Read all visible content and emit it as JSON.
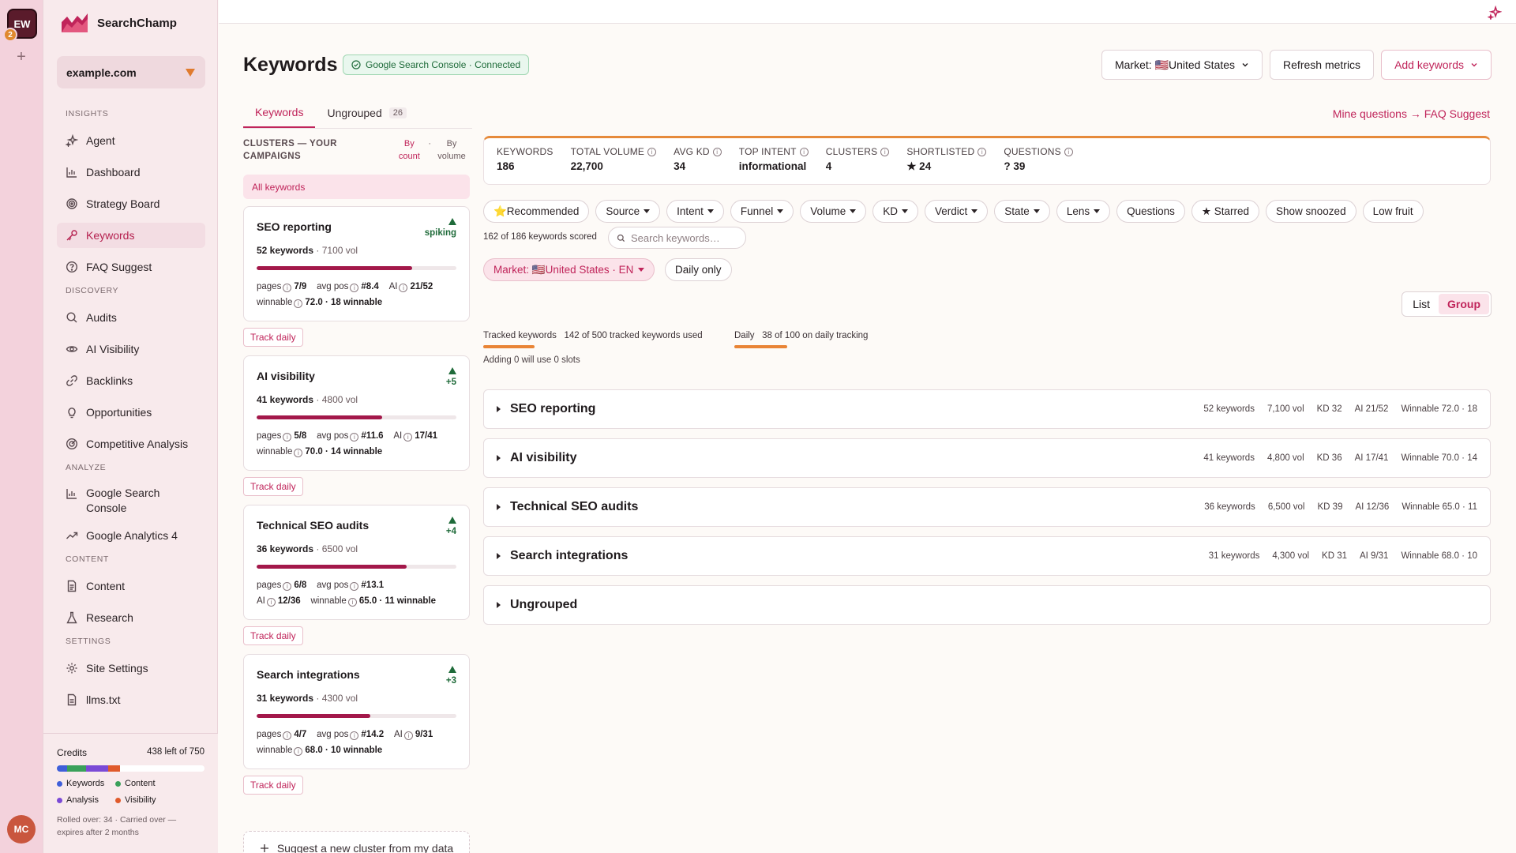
{
  "rail": {
    "workspace_initials": "EW",
    "workspace_badge": "2",
    "user_initials": "MC"
  },
  "sidebar": {
    "brand": "SearchChamp",
    "site": "example.com",
    "sections": {
      "insights": "INSIGHTS",
      "discovery": "DISCOVERY",
      "analyze": "ANALYZE",
      "content": "CONTENT",
      "settings": "SETTINGS"
    },
    "items": {
      "agent": "Agent",
      "dashboard": "Dashboard",
      "strategy_board": "Strategy Board",
      "keywords": "Keywords",
      "faq_suggest": "FAQ Suggest",
      "audits": "Audits",
      "ai_visibility": "AI Visibility",
      "backlinks": "Backlinks",
      "opportunities": "Opportunities",
      "competitive_analysis": "Competitive Analysis",
      "gsc": "Google Search Console",
      "ga4": "Google Analytics 4",
      "content": "Content",
      "research": "Research",
      "site_settings": "Site Settings",
      "llms": "llms.txt"
    },
    "credits": {
      "label": "Credits",
      "remaining": "438 left of 750",
      "segments": [
        {
          "name": "Keywords",
          "color": "#3f5fd9",
          "fraction": 0.07
        },
        {
          "name": "Content",
          "color": "#3aa05a",
          "fraction": 0.13
        },
        {
          "name": "Analysis",
          "color": "#7b4ad6",
          "fraction": 0.15
        },
        {
          "name": "Visibility",
          "color": "#e05a2b",
          "fraction": 0.08
        }
      ],
      "legend": {
        "keywords": "Keywords",
        "content": "Content",
        "analysis": "Analysis",
        "visibility": "Visibility"
      },
      "note": "Rolled over: 34 · Carried over — expires after 2 months"
    }
  },
  "header": {
    "title": "Keywords",
    "gsc_badge": "Google Search Console · Connected",
    "market_btn": "Market: 🇺🇸United States",
    "refresh_btn": "Refresh metrics",
    "add_btn": "Add keywords",
    "faq_link": "Mine questions → FAQ Suggest"
  },
  "tabs": [
    {
      "label": "Keywords"
    },
    {
      "label": "Ungrouped",
      "count": "26"
    }
  ],
  "clusters": {
    "heading": "CLUSTERS — YOUR CAMPAIGNS",
    "sort_by_count": "By count",
    "sort_by_volume": "By volume",
    "all_keywords": "All keywords",
    "track_label": "Track daily",
    "suggest_label": "Suggest a new cluster from my data",
    "labels": {
      "pages": "pages",
      "avg_pos": "avg pos",
      "ai": "AI",
      "winnable": "winnable"
    },
    "items": [
      {
        "name": "SEO reporting",
        "keywords": "52 keywords",
        "vol": "7100 vol",
        "trend": "spiking",
        "progress": 0.78,
        "pages": "7/9",
        "avg_pos": "#8.4",
        "ai": "21/52",
        "winnable": "72.0 · 18 winnable"
      },
      {
        "name": "AI visibility",
        "keywords": "41 keywords",
        "vol": "4800 vol",
        "trend": "+5",
        "progress": 0.63,
        "pages": "5/8",
        "avg_pos": "#11.6",
        "ai": "17/41",
        "winnable": "70.0 · 14 winnable"
      },
      {
        "name": "Technical SEO audits",
        "keywords": "36 keywords",
        "vol": "6500 vol",
        "trend": "+4",
        "progress": 0.75,
        "pages": "6/8",
        "avg_pos": "#13.1",
        "ai": "12/36",
        "winnable": "65.0 · 11 winnable"
      },
      {
        "name": "Search integrations",
        "keywords": "31 keywords",
        "vol": "4300 vol",
        "trend": "+3",
        "progress": 0.57,
        "pages": "4/7",
        "avg_pos": "#14.2",
        "ai": "9/31",
        "winnable": "68.0 · 10 winnable"
      }
    ]
  },
  "stats": [
    {
      "label": "KEYWORDS",
      "value": "186",
      "info": false
    },
    {
      "label": "TOTAL VOLUME",
      "value": "22,700",
      "info": true
    },
    {
      "label": "AVG KD",
      "value": "34",
      "info": true
    },
    {
      "label": "TOP INTENT",
      "value": "informational",
      "info": true
    },
    {
      "label": "CLUSTERS",
      "value": "4",
      "info": true
    },
    {
      "label": "SHORTLISTED",
      "value": "★ 24",
      "info": true
    },
    {
      "label": "QUESTIONS",
      "value": "? 39",
      "info": true
    }
  ],
  "filters": {
    "chips": [
      {
        "label": "⭐Recommended",
        "dropdown": false
      },
      {
        "label": "Source",
        "dropdown": true
      },
      {
        "label": "Intent",
        "dropdown": true
      },
      {
        "label": "Funnel",
        "dropdown": true
      },
      {
        "label": "Volume",
        "dropdown": true
      },
      {
        "label": "KD",
        "dropdown": true
      },
      {
        "label": "Verdict",
        "dropdown": true
      },
      {
        "label": "State",
        "dropdown": true
      },
      {
        "label": "Lens",
        "dropdown": true
      },
      {
        "label": "Questions",
        "dropdown": false
      },
      {
        "label": "★ Starred",
        "dropdown": false
      },
      {
        "label": "Show snoozed",
        "dropdown": false
      },
      {
        "label": "Low fruit",
        "dropdown": false
      }
    ],
    "scored": "162 of 186 keywords scored",
    "search_placeholder": "Search keywords…",
    "market_chip": "Market: 🇺🇸United States · EN",
    "daily_only": "Daily only"
  },
  "view_toggle": {
    "list": "List",
    "group": "Group",
    "selected": "Group"
  },
  "usage": {
    "tracked_label": "Tracked keywords",
    "tracked_value": "142 of 500 tracked keywords used",
    "tracked_fraction": 0.284,
    "daily_label": "Daily",
    "daily_value": "38 of 100 on daily tracking",
    "daily_fraction": 0.38,
    "adding_note": "Adding 0 will use 0 slots"
  },
  "groups": [
    {
      "name": "SEO reporting",
      "meta": [
        "52 keywords",
        "7,100 vol",
        "KD 32",
        "AI 21/52",
        "Winnable 72.0 · 18"
      ]
    },
    {
      "name": "AI visibility",
      "meta": [
        "41 keywords",
        "4,800 vol",
        "KD 36",
        "AI 17/41",
        "Winnable 70.0 · 14"
      ]
    },
    {
      "name": "Technical SEO audits",
      "meta": [
        "36 keywords",
        "6,500 vol",
        "KD 39",
        "AI 12/36",
        "Winnable 65.0 · 11"
      ]
    },
    {
      "name": "Search integrations",
      "meta": [
        "31 keywords",
        "4,300 vol",
        "KD 31",
        "AI 9/31",
        "Winnable 68.0 · 10"
      ]
    },
    {
      "name": "Ungrouped",
      "meta": []
    }
  ]
}
